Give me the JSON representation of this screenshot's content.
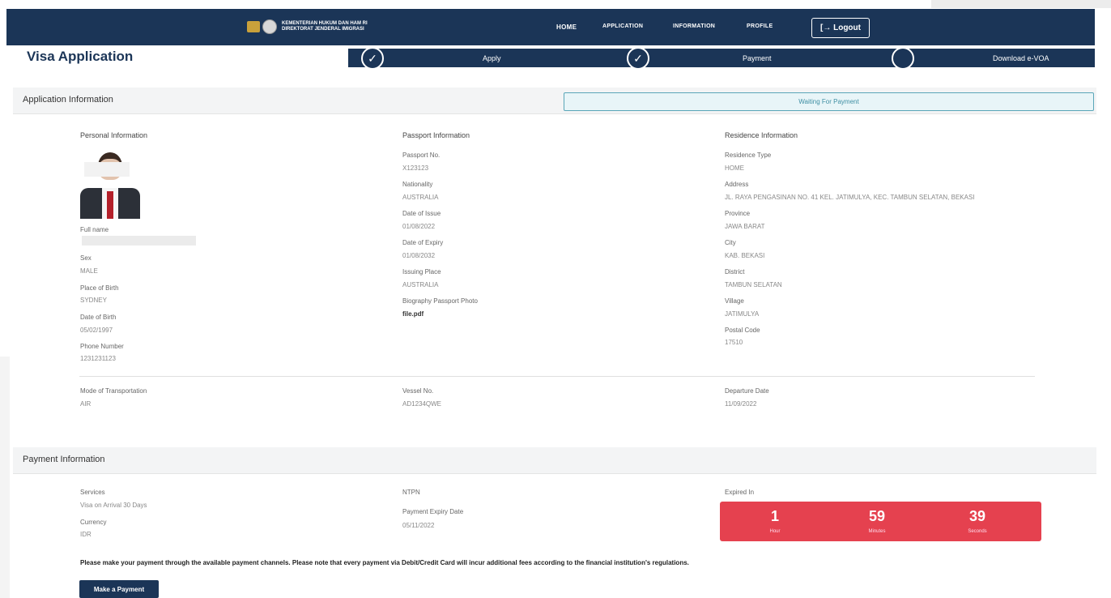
{
  "header": {
    "org_line1": "KEMENTERIAN HUKUM DAN HAM RI",
    "org_line2": "DIREKTORAT JENDERAL IMIGRASI",
    "nav": [
      "HOME",
      "APPLICATION",
      "INFORMATION",
      "PROFILE"
    ],
    "logout_label": "[→ Logout"
  },
  "page": {
    "title": "Visa Application",
    "steps": [
      {
        "label": "Apply",
        "done": true
      },
      {
        "label": "Payment",
        "done": true
      },
      {
        "label": "Download e-VOA",
        "done": false
      }
    ]
  },
  "application": {
    "section_title": "Application Information",
    "status": "Waiting For Payment",
    "personal": {
      "heading": "Personal Information",
      "full_name_label": "Full name",
      "full_name_value": "",
      "sex_label": "Sex",
      "sex_value": "MALE",
      "pob_label": "Place of Birth",
      "pob_value": "SYDNEY",
      "dob_label": "Date of Birth",
      "dob_value": "05/02/1997",
      "phone_label": "Phone Number",
      "phone_value": "1231231123"
    },
    "passport": {
      "heading": "Passport Information",
      "no_label": "Passport No.",
      "no_value": "X123123",
      "nationality_label": "Nationality",
      "nationality_value": "AUSTRALIA",
      "issue_label": "Date of Issue",
      "issue_value": "01/08/2022",
      "expiry_label": "Date of Expiry",
      "expiry_value": "01/08/2032",
      "place_label": "Issuing Place",
      "place_value": "AUSTRALIA",
      "photo_label": "Biography Passport Photo",
      "photo_value": "file.pdf"
    },
    "residence": {
      "heading": "Residence Information",
      "type_label": "Residence Type",
      "type_value": "HOME",
      "address_label": "Address",
      "address_value": "JL. RAYA PENGASINAN NO. 41 KEL. JATIMULYA, KEC. TAMBUN SELATAN, BEKASI",
      "province_label": "Province",
      "province_value": "JAWA BARAT",
      "city_label": "City",
      "city_value": "KAB. BEKASI",
      "district_label": "District",
      "district_value": "TAMBUN SELATAN",
      "village_label": "Village",
      "village_value": "JATIMULYA",
      "postal_label": "Postal Code",
      "postal_value": "17510"
    },
    "travel": {
      "mode_label": "Mode of Transportation",
      "mode_value": "AIR",
      "vessel_label": "Vessel No.",
      "vessel_value": "AD1234QWE",
      "departure_label": "Departure Date",
      "departure_value": "11/09/2022"
    }
  },
  "payment": {
    "section_title": "Payment Information",
    "services_label": "Services",
    "services_value": "Visa on Arrival 30 Days",
    "currency_label": "Currency",
    "currency_value": "IDR",
    "ntpn_label": "NTPN",
    "expiry_label": "Payment Expiry Date",
    "expiry_value": "05/11/2022",
    "expired_in_label": "Expired In",
    "timer": {
      "hours": "1",
      "hours_unit": "Hour",
      "minutes": "59",
      "minutes_unit": "Minutes",
      "seconds": "39",
      "seconds_unit": "Seconds"
    },
    "note": "Please make your payment through the available payment channels. Please note that every payment via Debit/Credit Card will incur additional fees according to the financial institution's regulations.",
    "button_label": "Make a Payment"
  },
  "colors": {
    "navy": "#1b3557",
    "alert_red": "#e5414f",
    "status_border": "#5aa6b8"
  }
}
